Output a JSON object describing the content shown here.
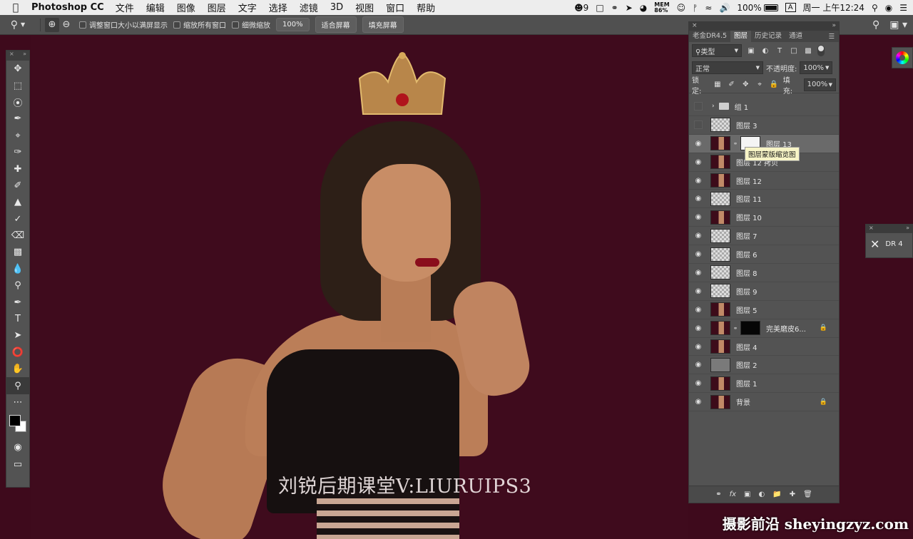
{
  "menubar": {
    "app_name": "Photoshop CC",
    "items": [
      "文件",
      "编辑",
      "图像",
      "图层",
      "文字",
      "选择",
      "滤镜",
      "3D",
      "视图",
      "窗口",
      "帮助"
    ],
    "status": {
      "notif_count": "9",
      "mem_label": "MEM",
      "mem_value": "86%",
      "battery": "100%",
      "battery_fraction": 1.0,
      "input_method": "A",
      "clock": "周一 上午12:24"
    }
  },
  "options_bar": {
    "checks": [
      "调整窗口大小以满屏显示",
      "缩放所有窗口",
      "细微缩放"
    ],
    "zoom_value": "100%",
    "buttons": [
      "适合屏幕",
      "填充屏幕"
    ]
  },
  "canvas": {
    "watermark": "刘锐后期课堂V:LIURUIPS3"
  },
  "layers_panel": {
    "tabs": [
      "老金DR4.5",
      "图层",
      "历史记录",
      "通道"
    ],
    "active_tab": "图层",
    "filter_label": "类型",
    "blend_mode": "正常",
    "opacity_label": "不透明度:",
    "opacity_value": "100%",
    "lock_label": "锁定:",
    "fill_label": "填充:",
    "fill_value": "100%",
    "layers": [
      {
        "name": "组 1",
        "visible": false,
        "kind": "group"
      },
      {
        "name": "图层 3",
        "visible": false,
        "kind": "trans"
      },
      {
        "name": "图层 13",
        "visible": true,
        "kind": "photo",
        "mask": "white",
        "selected": true
      },
      {
        "name": "图层 12 拷贝",
        "visible": true,
        "kind": "photo"
      },
      {
        "name": "图层 12",
        "visible": true,
        "kind": "photo"
      },
      {
        "name": "图层 11",
        "visible": true,
        "kind": "trans"
      },
      {
        "name": "图层 10",
        "visible": true,
        "kind": "photo"
      },
      {
        "name": "图层 7",
        "visible": true,
        "kind": "trans"
      },
      {
        "name": "图层 6",
        "visible": true,
        "kind": "trans"
      },
      {
        "name": "图层 8",
        "visible": true,
        "kind": "trans"
      },
      {
        "name": "图层 9",
        "visible": true,
        "kind": "trans"
      },
      {
        "name": "图层 5",
        "visible": true,
        "kind": "photo"
      },
      {
        "name": "完美磨皮6...",
        "visible": true,
        "kind": "photo",
        "mask": "black",
        "locked": true
      },
      {
        "name": "图层 4",
        "visible": true,
        "kind": "photo"
      },
      {
        "name": "图层 2",
        "visible": true,
        "kind": "gray"
      },
      {
        "name": "图层 1",
        "visible": true,
        "kind": "photo"
      },
      {
        "name": "背景",
        "visible": true,
        "kind": "photo",
        "locked": true
      }
    ],
    "tooltip": "图层蒙版缩览图"
  },
  "dr4_panel": {
    "label": "DR 4"
  },
  "site_watermark": "摄影前沿 sheyingzyz.com",
  "colors": {
    "canvas_bg": "#3f0b1d",
    "panel_bg": "#535353",
    "menubar_bg": "#ededed"
  }
}
